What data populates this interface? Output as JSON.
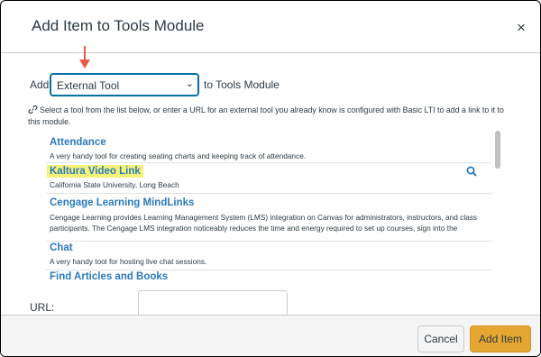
{
  "dialog": {
    "title": "Add Item to Tools Module",
    "close_label": "×"
  },
  "add_row": {
    "prefix": "Add",
    "selected_type": "External Tool",
    "suffix": "to Tools Module"
  },
  "description": "Select a tool from the list below, or enter a URL for an external tool you already know is configured with Basic LTI to add a link to it to this module.",
  "tools": [
    {
      "name": "Attendance",
      "desc": "A very handy tool for creating seating charts and keeping track of attendance."
    },
    {
      "name": "Kaltura Video Link",
      "desc": "California State University, Long Beach"
    },
    {
      "name": "Cengage Learning MindLinks",
      "desc": "Cengage Learning provides Learning Management System (LMS) integration on Canvas for administrators, instructors, and class participants. The Cengage LMS integration noticeably reduces the time and energy required to set up courses, sign into the"
    },
    {
      "name": "Chat",
      "desc": "A very handy tool for hosting live chat sessions."
    },
    {
      "name": "Find Articles and Books",
      "desc": ""
    }
  ],
  "url_field": {
    "label": "URL:",
    "value": ""
  },
  "footer": {
    "cancel_label": "Cancel",
    "add_label": "Add Item"
  },
  "colors": {
    "accent_blue": "#0770a3",
    "link_blue": "#2b7abc",
    "highlight": "#f5f27a",
    "add_button": "#e6a632",
    "arrow": "#e8594a"
  }
}
